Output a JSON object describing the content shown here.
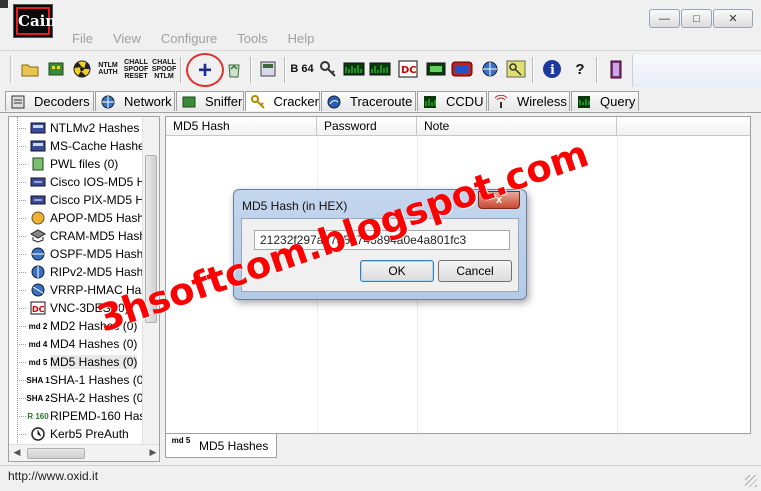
{
  "window": {
    "app_logo_text": "Cain",
    "controls": [
      "minimize",
      "maximize",
      "close"
    ]
  },
  "menu": [
    "File",
    "View",
    "Configure",
    "Tools",
    "Help"
  ],
  "toolbar": {
    "buttons": [
      {
        "name": "open",
        "label": ""
      },
      {
        "name": "sniffer",
        "label": ""
      },
      {
        "name": "radiation",
        "label": ""
      },
      {
        "name": "ntlm-auth",
        "label": "NTLM AUTH"
      },
      {
        "name": "chall-spoof-reset",
        "label": "CHALL SPOOF RESET"
      },
      {
        "name": "chall-spoof-ntlm",
        "label": "CHALL SPOOF NTLM"
      },
      {
        "name": "add",
        "label": "+"
      },
      {
        "name": "recycle",
        "label": ""
      },
      {
        "name": "hash",
        "label": ""
      },
      {
        "name": "base64",
        "label": "B 64"
      },
      {
        "name": "tool1",
        "label": ""
      },
      {
        "name": "tool2",
        "label": ""
      },
      {
        "name": "tool3",
        "label": ""
      },
      {
        "name": "tool4",
        "label": ""
      },
      {
        "name": "tool5",
        "label": ""
      },
      {
        "name": "tool6",
        "label": ""
      },
      {
        "name": "tool7",
        "label": ""
      },
      {
        "name": "tool8",
        "label": ""
      },
      {
        "name": "info",
        "label": "i"
      },
      {
        "name": "help",
        "label": "?"
      },
      {
        "name": "exit",
        "label": ""
      }
    ]
  },
  "tabs": [
    "Decoders",
    "Network",
    "Sniffer",
    "Cracker",
    "Traceroute",
    "CCDU",
    "Wireless",
    "Query"
  ],
  "tree": [
    {
      "label": "NTLMv2 Hashes (",
      "icon": ""
    },
    {
      "label": "MS-Cache Hashes",
      "icon": ""
    },
    {
      "label": "PWL files (0)",
      "icon": ""
    },
    {
      "label": "Cisco IOS-MD5 H",
      "icon": ""
    },
    {
      "label": "Cisco PIX-MD5 H",
      "icon": ""
    },
    {
      "label": "APOP-MD5 Hashe",
      "icon": ""
    },
    {
      "label": "CRAM-MD5 Hash",
      "icon": ""
    },
    {
      "label": "OSPF-MD5 Hashe",
      "icon": ""
    },
    {
      "label": "RIPv2-MD5 Hashe",
      "icon": ""
    },
    {
      "label": "VRRP-HMAC Has",
      "icon": ""
    },
    {
      "label": "VNC-3DES (0)",
      "icon": ""
    },
    {
      "label": "MD2 Hashes (0)",
      "icon": "md 2"
    },
    {
      "label": "MD4 Hashes (0)",
      "icon": "md 4"
    },
    {
      "label": "MD5 Hashes (0)",
      "icon": "md 5"
    },
    {
      "label": "SHA-1 Hashes (0)",
      "icon": "SHA 1"
    },
    {
      "label": "SHA-2 Hashes (0)",
      "icon": "SHA 2"
    },
    {
      "label": "RIPEMD-160 Hash",
      "icon": "R 160"
    },
    {
      "label": "Kerb5 PreAuth",
      "icon": ""
    }
  ],
  "table": {
    "columns": [
      "MD5 Hash",
      "Password",
      "Note"
    ]
  },
  "bottom_tab": {
    "label": "MD5 Hashes",
    "icon": "md 5"
  },
  "status": {
    "text": "http://www.oxid.it"
  },
  "dialog": {
    "title": "MD5 Hash (in HEX)",
    "close": "x",
    "value": "21232f297a57a5a743894a0e4a801fc3",
    "ok": "OK",
    "cancel": "Cancel"
  },
  "watermark": "3hsoftcom.blogspot.com",
  "colors": {
    "accent_red": "#ff0000",
    "dialog_frame": "#b4cae6",
    "plus_blue": "#1c2f8c"
  }
}
